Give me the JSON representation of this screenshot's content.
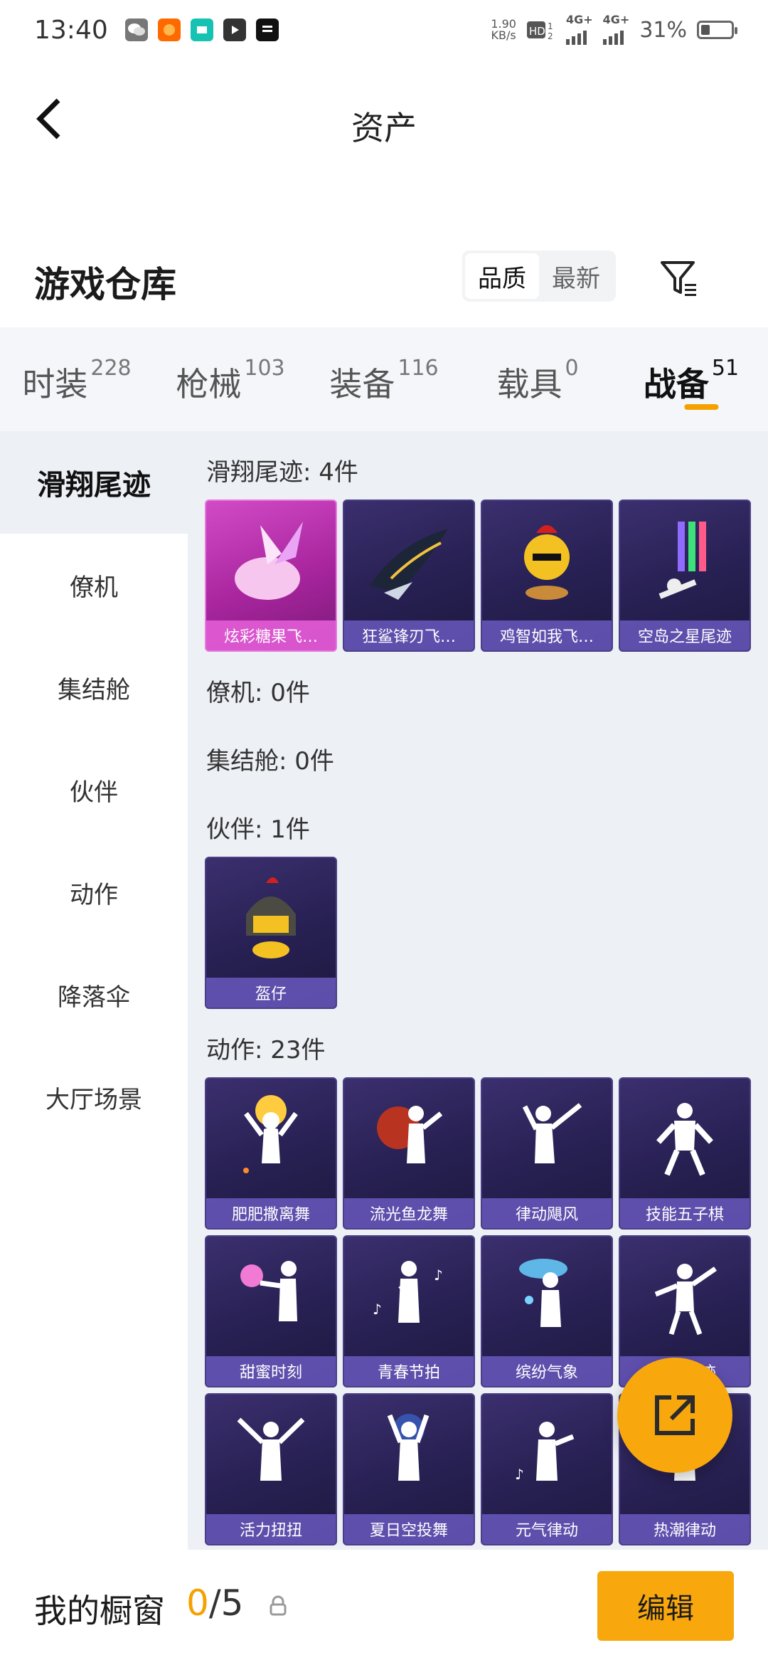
{
  "status_bar": {
    "time": "13:40",
    "net_speed_value": "1.90",
    "net_speed_unit": "KB/s",
    "sim1_label": "4G+",
    "sim2_label": "4G+",
    "battery": "31%",
    "apps": [
      {
        "icon": "wechat-icon",
        "color": "#777777"
      },
      {
        "icon": "taobao-icon",
        "color": "#ff6a00"
      },
      {
        "icon": "boss-icon",
        "color": "#16c2b2"
      },
      {
        "icon": "video-play-icon",
        "color": "#333333"
      },
      {
        "icon": "news-icon",
        "color": "#111111"
      }
    ]
  },
  "header": {
    "title": "资产"
  },
  "warehouse": {
    "title": "游戏仓库",
    "sort_options": [
      "品质",
      "最新"
    ],
    "active_sort": "品质"
  },
  "category_tabs": [
    {
      "label": "时装",
      "count": "228"
    },
    {
      "label": "枪械",
      "count": "103"
    },
    {
      "label": "装备",
      "count": "116"
    },
    {
      "label": "载具",
      "count": "0"
    },
    {
      "label": "战备",
      "count": "51",
      "active": true
    }
  ],
  "side_nav": [
    {
      "label": "滑翔尾迹",
      "active": true
    },
    {
      "label": "僚机"
    },
    {
      "label": "集结舱"
    },
    {
      "label": "伙伴"
    },
    {
      "label": "动作"
    },
    {
      "label": "降落伞"
    },
    {
      "label": "大厅场景"
    }
  ],
  "sections": {
    "trail": {
      "heading": "滑翔尾迹: 4件",
      "items": [
        "炫彩糖果飞…",
        "狂鲨锋刃飞…",
        "鸡智如我飞…",
        "空岛之星尾迹"
      ]
    },
    "wingman": {
      "heading": "僚机: 0件"
    },
    "pod": {
      "heading": "集结舱: 0件"
    },
    "partner": {
      "heading": "伙伴: 1件",
      "items": [
        "盔仔"
      ]
    },
    "emote": {
      "heading": "动作: 23件",
      "items": [
        "肥肥撒离舞",
        "流光鱼龙舞",
        "律动飓风",
        "技能五子棋",
        "甜蜜时刻",
        "青春节拍",
        "缤纷气象",
        "青春轨迹",
        "活力扭扭",
        "夏日空投舞",
        "元气律动",
        "热潮律动"
      ]
    }
  },
  "bottom_bar": {
    "showcase_title": "我的橱窗",
    "showcase_current": "0",
    "showcase_total": "/5",
    "edit_label": "编辑"
  },
  "colors": {
    "accent": "#f8a80c",
    "card_bg": "#2b2358",
    "card_label": "#6a58be",
    "card_pink": "#c53bb9"
  }
}
